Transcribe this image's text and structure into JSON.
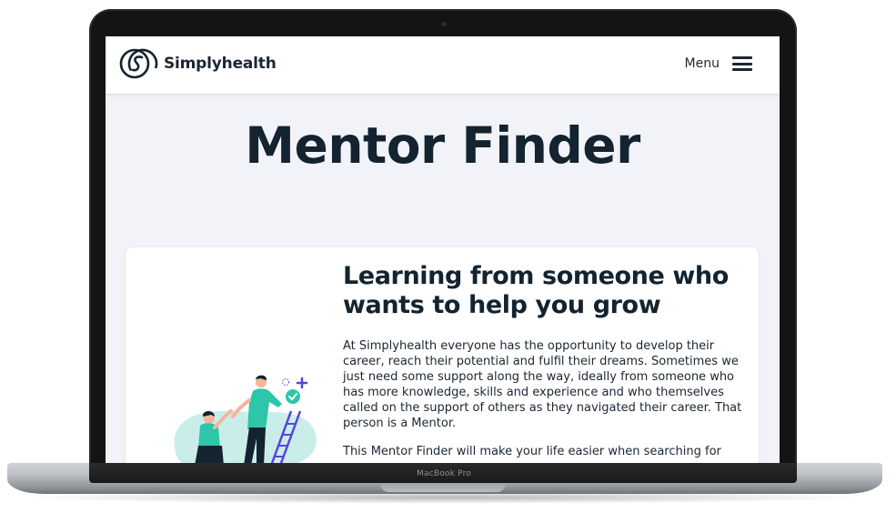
{
  "device": {
    "model_label": "MacBook Pro"
  },
  "header": {
    "brand_name": "Simplyhealth",
    "menu_label": "Menu",
    "logo_icon": "simplyhealth-logo-icon",
    "menu_icon": "hamburger-menu-icon"
  },
  "main": {
    "page_title": "Mentor Finder",
    "card": {
      "heading": "Learning from someone who wants to help you grow",
      "paragraph_1": "At Simplyhealth everyone has the opportunity to develop their career, reach their potential and fulfil their dreams. Sometimes we just need some support along the way, ideally from someone who has more knowledge, skills and experience and who themselves called on the support of others as they navigated their career. That person is a Mentor.",
      "paragraph_2": "This Mentor Finder will make your life easier when searching for"
    }
  },
  "colors": {
    "brand_dark": "#13232f",
    "illustration_teal": "#2dc6a8",
    "illustration_blob": "#c9eee9",
    "illustration_ladder": "#5a43e0"
  }
}
